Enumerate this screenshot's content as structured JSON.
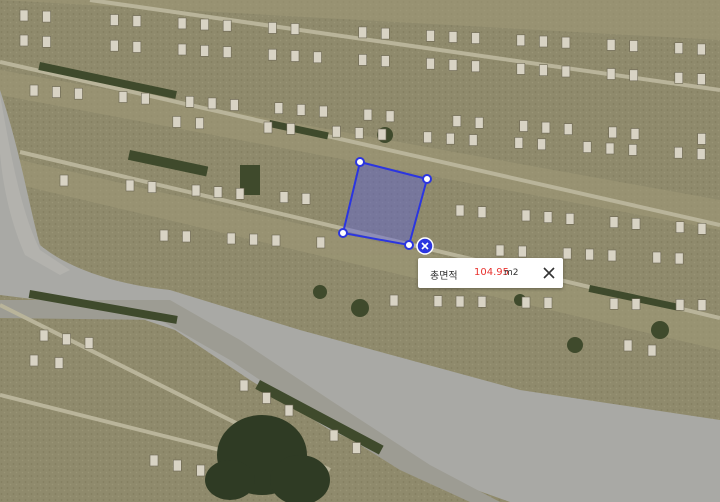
{
  "map": {
    "type": "satellite-aerial",
    "measure_tool": {
      "shape": "polygon",
      "fill_color": "#5a5fd6",
      "stroke_color": "#2b35e0",
      "vertex_color": "#ffffff"
    }
  },
  "popup": {
    "label": "총면적",
    "value": "104.95",
    "unit": "m2",
    "value_color": "#e8322e",
    "close_icon": "close-icon"
  },
  "delete_marker": {
    "icon": "delete-x-icon",
    "color": "#2b35e0"
  }
}
